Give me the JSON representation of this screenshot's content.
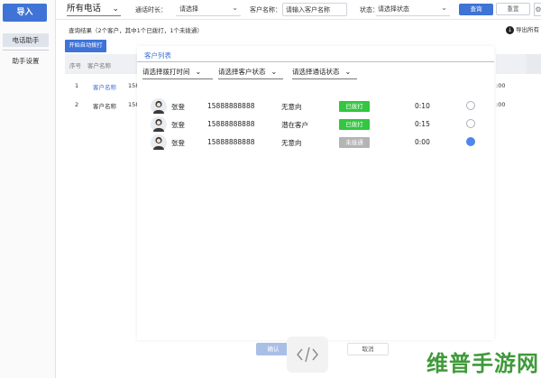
{
  "sidebar": {
    "import_label": "导入",
    "items": [
      {
        "label": "电话助手",
        "active": true
      },
      {
        "label": "助手设置",
        "active": false
      }
    ]
  },
  "topbar": {
    "call_type": "所有电话",
    "duration_label": "通话时长：",
    "duration_value": "请选择",
    "customer_label": "客户名称：",
    "customer_placeholder": "请输入客户名称",
    "status_label": "状态：",
    "status_value": "请选择状态",
    "query_label": "查询",
    "reset_label": "重置"
  },
  "result": {
    "summary": "查询结果（2个客户，其中1个已拨打，1个未拨通）",
    "export_label": "导出所有",
    "auto_dial_label": "开始自动拨打"
  },
  "bg_table": {
    "headers": [
      "序号",
      "客户名称"
    ],
    "rows": [
      {
        "index": "1",
        "name": "客户名称",
        "phone": "158",
        "right": ":00"
      },
      {
        "index": "2",
        "name": "客户名称",
        "phone": "158",
        "right": ":00"
      }
    ]
  },
  "modal": {
    "title": "客户列表",
    "filters": [
      "请选择拨打时间",
      "请选择客户状态",
      "请选择通话状态"
    ],
    "customers": [
      {
        "name": "张登",
        "phone": "15888888888",
        "intent": "无意向",
        "status": "已拨打",
        "status_type": "dialed",
        "duration": "0:10",
        "selected": false
      },
      {
        "name": "张登",
        "phone": "15888888888",
        "intent": "潜在客户",
        "status": "已拨打",
        "status_type": "dialed",
        "duration": "0:15",
        "selected": false
      },
      {
        "name": "张登",
        "phone": "15888888888",
        "intent": "无意向",
        "status": "未接通",
        "status_type": "notdialed",
        "duration": "0:00",
        "selected": true
      }
    ],
    "confirm_label": "确认",
    "cancel_label": "取消"
  },
  "overlay": {
    "code_glyph": "</>"
  },
  "watermark": "维普手游网",
  "colors": {
    "primary": "#3f73d6",
    "dialed": "#33c63f",
    "not_dialed": "#b4b4b4",
    "selected_radio": "#4f86e8"
  }
}
